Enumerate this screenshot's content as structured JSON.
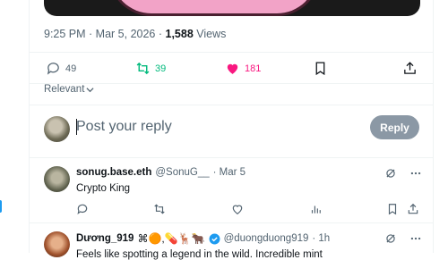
{
  "tweet_meta": {
    "time": "9:25 PM",
    "sep": " · ",
    "date": "Mar 5, 2026",
    "views_count": "1,588",
    "views_label": " Views"
  },
  "actions": {
    "replies": "49",
    "reposts": "39",
    "likes": "181"
  },
  "sort": {
    "label": "Relevant"
  },
  "compose": {
    "placeholder": "Post your reply",
    "reply_label": "Reply"
  },
  "posts": [
    {
      "name": "sonug.base.eth",
      "handle": "@SonuG__",
      "date": "· Mar 5",
      "text": "Crypto King"
    },
    {
      "name": "Dương_919",
      "badges": "⌘🟠,💊🦌🐂",
      "handle": "@duongduong919",
      "date": "· 1h",
      "text": "Feels like spotting a legend in the wild. Incredible mint"
    }
  ],
  "colors": {
    "repost_green": "#00ba7c",
    "like_pink": "#f91880",
    "reply_gray": "#8b98a5",
    "verified_blue": "#1d9bf0"
  }
}
